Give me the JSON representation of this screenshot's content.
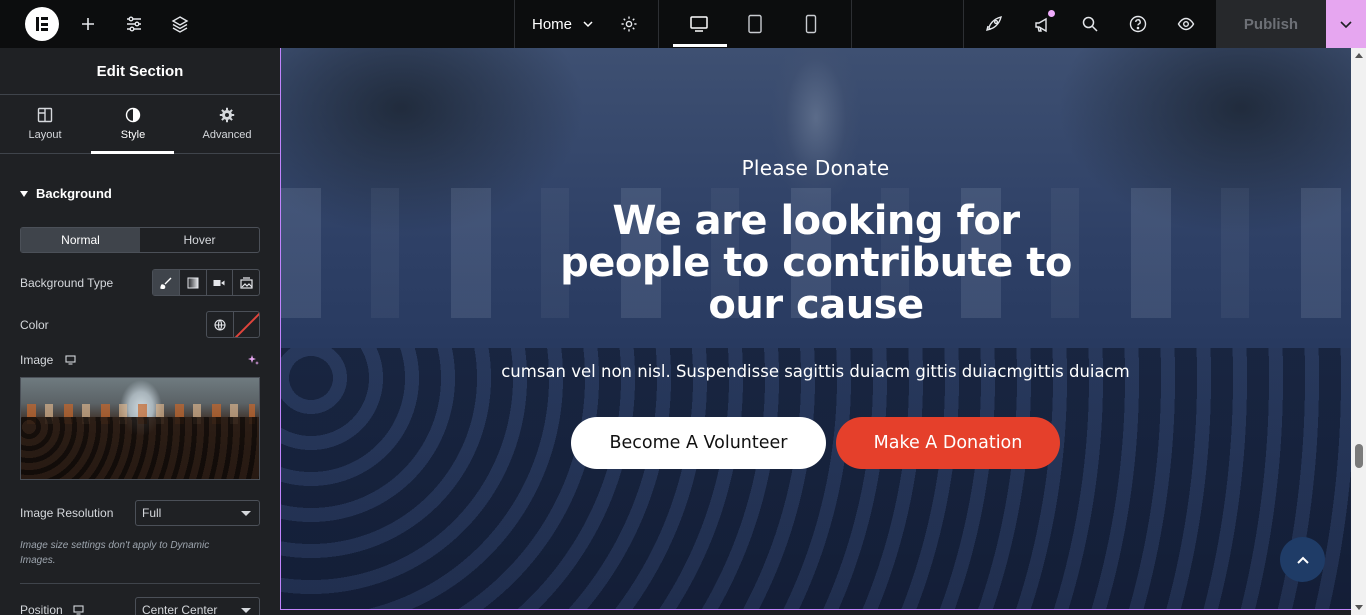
{
  "topbar": {
    "page_selector": "Home",
    "publish_label": "Publish",
    "icons": [
      "elementor-logo-icon",
      "add-icon",
      "site-settings-icon",
      "structure-layers-icon",
      "chevron-down-icon",
      "page-settings-gear-icon",
      "desktop-icon",
      "tablet-icon",
      "mobile-icon",
      "rocket-icon",
      "megaphone-icon",
      "search-icon",
      "help-icon",
      "preview-eye-icon",
      "chevron-down-icon"
    ],
    "accent_color": "#e6a6f0"
  },
  "sidebar": {
    "title": "Edit Section",
    "tabs": [
      {
        "label": "Layout",
        "icon": "layout-columns-icon"
      },
      {
        "label": "Style",
        "icon": "half-circle-style-icon",
        "active": true
      },
      {
        "label": "Advanced",
        "icon": "gear-icon"
      }
    ],
    "section": "Background",
    "state_toggle": {
      "normal": "Normal",
      "hover": "Hover",
      "selected": "Normal"
    },
    "background_type_label": "Background Type",
    "background_type_options": [
      "brush-classic-icon",
      "gradient-icon",
      "video-icon",
      "slideshow-icon"
    ],
    "color_label": "Color",
    "image_label": "Image",
    "image_resolution_label": "Image Resolution",
    "image_resolution_value": "Full",
    "image_note": "Image size settings don't apply to Dynamic Images.",
    "position_label": "Position",
    "position_value": "Center Center"
  },
  "hero": {
    "eyebrow": "Please Donate",
    "heading": "We are looking for people to contribute to our cause",
    "subtext": "cumsan vel non nisl. Suspendisse sagittis duiacm gittis duiacmgittis duiacm",
    "btn_volunteer": "Become A Volunteer",
    "btn_donate": "Make A Donation",
    "donate_color": "#e5402b",
    "overlay_color": "#26385e"
  }
}
